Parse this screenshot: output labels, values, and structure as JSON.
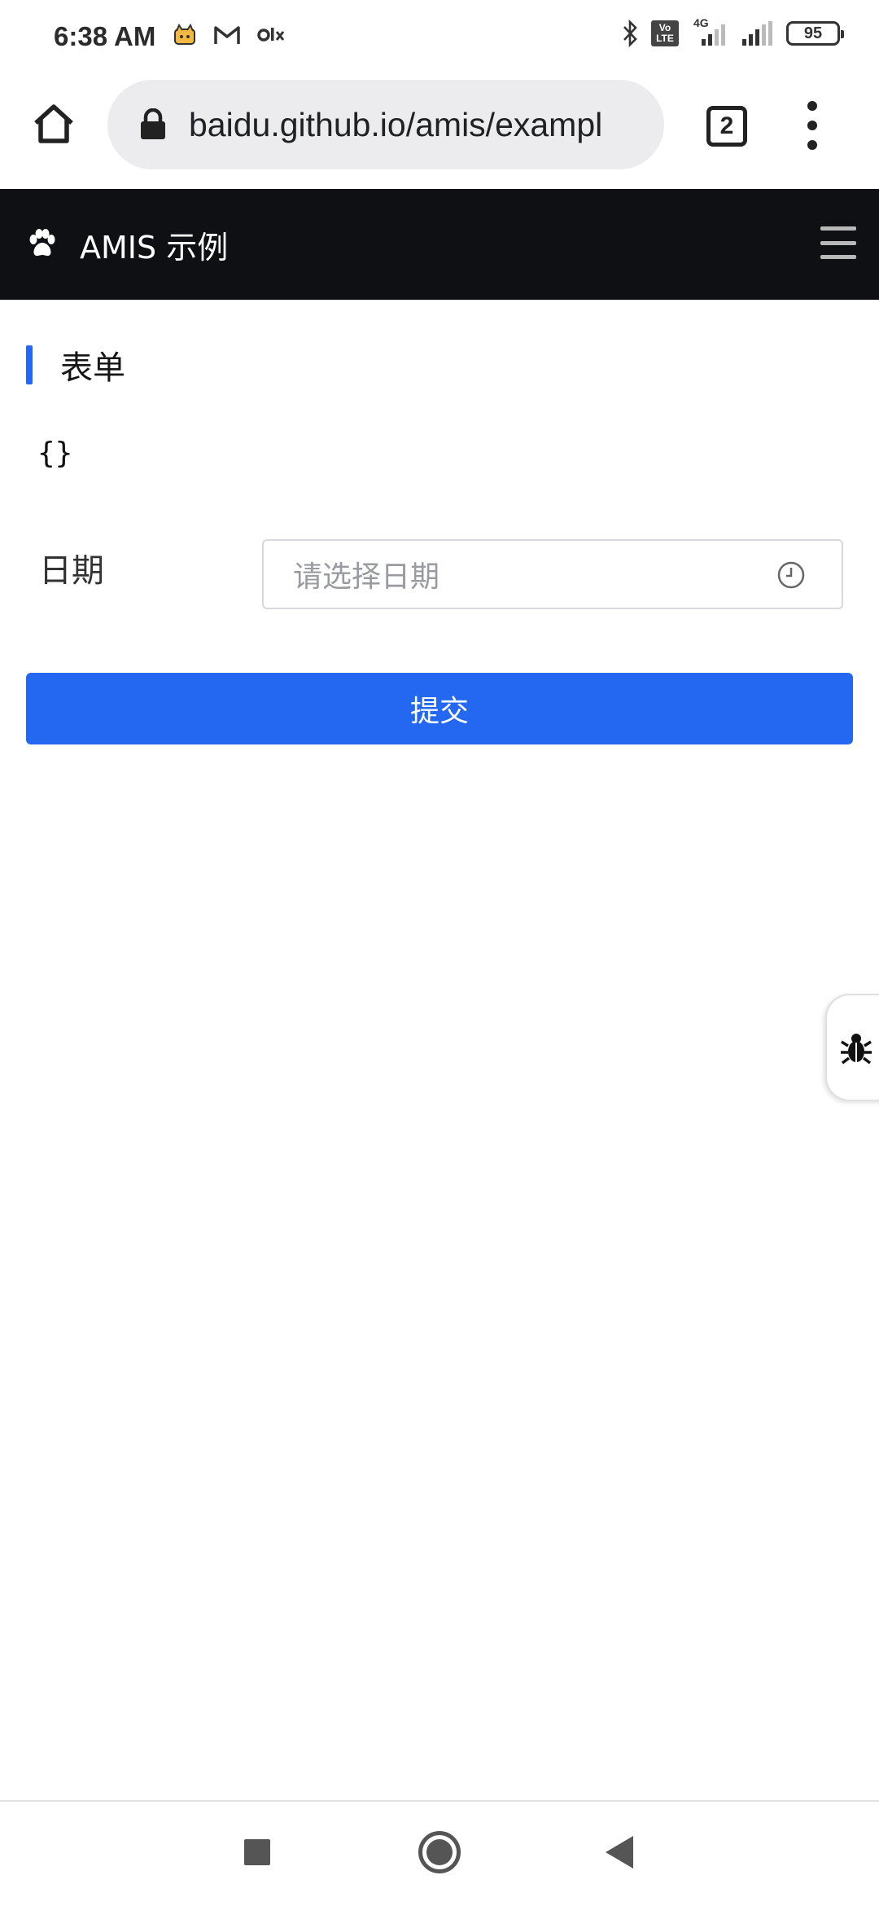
{
  "status_bar": {
    "time": "6:38 AM",
    "network": "4G",
    "lte_badge": "Vo LTE",
    "battery": "95"
  },
  "browser": {
    "url": "baidu.github.io/amis/exampl",
    "tab_count": "2"
  },
  "app": {
    "title": "AMIS 示例"
  },
  "page": {
    "title": "表单",
    "json_preview": "{}",
    "form": {
      "date_label": "日期",
      "date_placeholder": "请选择日期",
      "submit_label": "提交"
    }
  },
  "colors": {
    "primary": "#2468f2",
    "header_bg": "#0f1013"
  }
}
